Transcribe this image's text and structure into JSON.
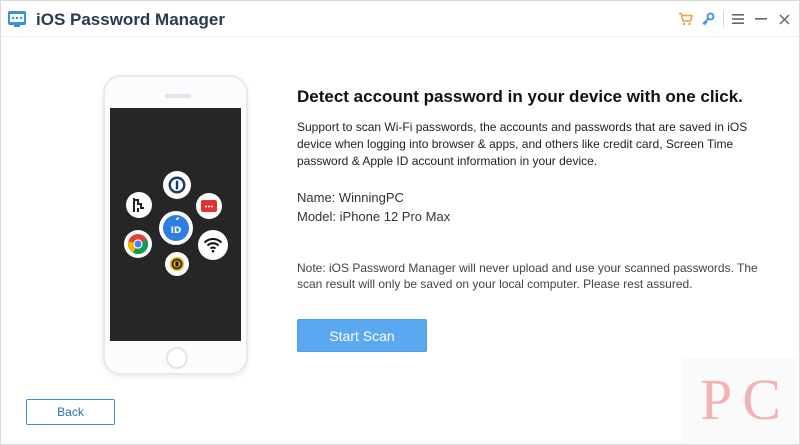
{
  "app": {
    "title": "iOS Password Manager"
  },
  "titlebar": {
    "icons": [
      "cart-icon",
      "key-icon",
      "menu-icon",
      "minimize-icon",
      "close-icon"
    ]
  },
  "phone": {
    "app_icons": [
      "onepassword-icon",
      "id-apple-icon",
      "creditcard-icon",
      "chrome-icon",
      "wifi-icon",
      "app-icon",
      "coin-icon"
    ]
  },
  "main": {
    "headline": "Detect account password in your device with one click.",
    "description": "Support to scan Wi-Fi passwords, the accounts and passwords that are saved in iOS device when logging into browser & apps, and others like credit card, Screen Time password & Apple ID account information in your device.",
    "device_name": "Name: WinningPC",
    "device_model": "Model: iPhone 12 Pro Max",
    "note": "Note: iOS Password Manager will never upload and use your scanned passwords. The scan result will only be saved on your local computer. Please rest assured.",
    "start_label": "Start Scan"
  },
  "footer": {
    "back_label": "Back"
  },
  "watermark": {
    "left": "P",
    "right": "C"
  },
  "colors": {
    "accent": "#5aa8ef",
    "title": "#2b3a4f",
    "cart": "#e8a33a",
    "key": "#3a8ee6"
  }
}
